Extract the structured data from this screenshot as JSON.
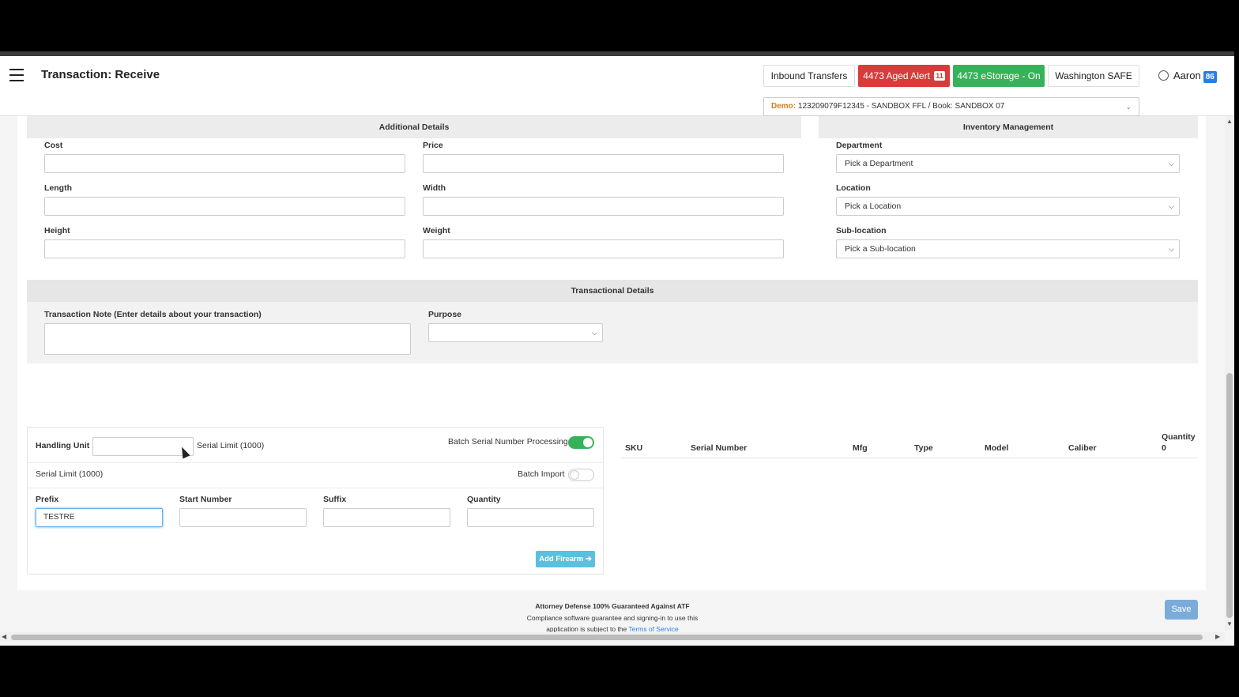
{
  "header": {
    "title": "Transaction: Receive",
    "buttons": {
      "inbound": "Inbound Transfers",
      "aged_alert": "4473 Aged Alert",
      "aged_alert_count": "11",
      "estorage": "4473 eStorage - On",
      "washington": "Washington SAFE"
    },
    "user": {
      "name": "Aaron",
      "badge": "86"
    },
    "book_select": {
      "prefix": "Demo:",
      "value": "123209079F12345 - SANDBOX FFL / Book: SANDBOX 07"
    }
  },
  "additional_details": {
    "heading": "Additional Details",
    "cost_label": "Cost",
    "price_label": "Price",
    "length_label": "Length",
    "width_label": "Width",
    "height_label": "Height",
    "weight_label": "Weight"
  },
  "inventory_management": {
    "heading": "Inventory Management",
    "department_label": "Department",
    "department_value": "Pick a Department",
    "location_label": "Location",
    "location_value": "Pick a Location",
    "sublocation_label": "Sub-location",
    "sublocation_value": "Pick a Sub-location"
  },
  "transactional_details": {
    "heading": "Transactional Details",
    "note_label": "Transaction Note",
    "note_hint": "(Enter details about your transaction)",
    "purpose_label": "Purpose",
    "purpose_value": ""
  },
  "batch": {
    "handling_unit_label": "Handling Unit",
    "serial_limit_inline": "Serial Limit (1000)",
    "batch_serial_label": "Batch Serial Number Processing",
    "batch_serial_on": true,
    "serial_limit": "Serial Limit (1000)",
    "batch_import_label": "Batch Import",
    "batch_import_on": false,
    "prefix_label": "Prefix",
    "prefix_value": "TESTRE",
    "start_label": "Start Number",
    "suffix_label": "Suffix",
    "quantity_label": "Quantity",
    "add_button": "Add Firearm ➔"
  },
  "table": {
    "columns": [
      "SKU",
      "Serial Number",
      "Mfg",
      "Type",
      "Model",
      "Caliber"
    ],
    "quantity_label": "Quantity",
    "quantity_value": "0"
  },
  "save_button": "Save",
  "footer": {
    "line1": "Attorney Defense 100% Guaranteed Against ATF",
    "line2": "Compliance software guarantee and signing-in to use this",
    "line3": "application is subject to the",
    "link": "Terms of Service"
  },
  "colors": {
    "accent_red": "#d93a3a",
    "accent_green": "#36b35a",
    "accent_blue": "#5bc0de",
    "demo_orange": "#d67a1e"
  }
}
